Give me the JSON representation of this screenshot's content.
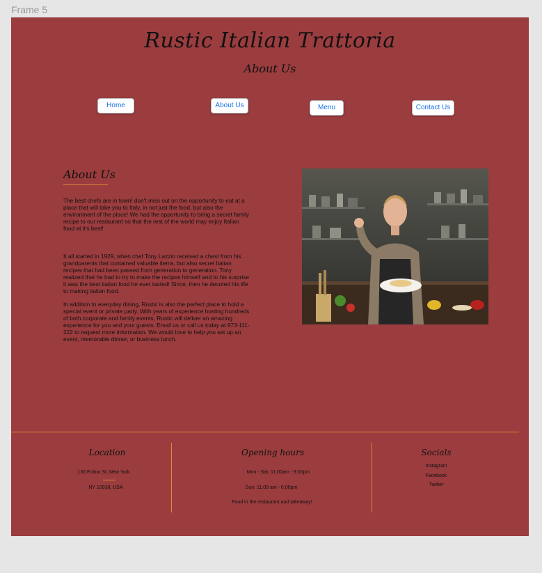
{
  "canvas": {
    "frame_label": "Frame 5"
  },
  "header": {
    "title": "Rustic Italian Trattoria",
    "subtitle": "About Us"
  },
  "nav": {
    "home": "Home",
    "about": "About Us",
    "menu": "Menu",
    "contact": "Contact Us"
  },
  "about": {
    "heading": "About Us",
    "p1": "The best chefs are in town! don't miss out on the opportunity to eat at a place that will take you to Italy, in not just the food, but also the environment of the place! We had the opportunity to bring a secret family recipe to our restaurant so that the rest of the world may enjoy Italian food at it's best!",
    "p2": "It all started in 1929, when chef Tony Lazzio received a chest from his grandparents that contained valuable items, but also secret Italian recipes that had been passed from generation to generation. Tony realized that he had to try to make the recipes himself and to his surprise it was the best italian food he ever tasted! Since, then he devoted his life to making italian food.",
    "p3": "In addition to everyday dining, Rustic is also the perfect place to hold a special event or private party. With years of experience hosting hundreds of both corporate and family events, Rustic will deliver an amazing experience for you and your guests. Email us or call us today at 973-111-222 to request more information. We would love to help you set up an event, memorable dinner, or business lunch."
  },
  "footer": {
    "location": {
      "heading": "Location",
      "line1": "130 Fulton St,  New York",
      "line2": "NY 10038, USA"
    },
    "hours": {
      "heading": "Opening hours",
      "line1": "Mon - Sat: 11:00am - 9:00pm",
      "line2": "Sun: 11:00 am - 6:00pm",
      "line3": "Food in the restaurant and takeaway!"
    },
    "socials": {
      "heading": "Socials",
      "links": [
        "Instagram",
        "Facebook",
        "Twitter"
      ]
    }
  },
  "colors": {
    "frame_bg": "#9b3c3e",
    "accent_line": "#d9903a",
    "nav_text": "#1a73e8"
  }
}
